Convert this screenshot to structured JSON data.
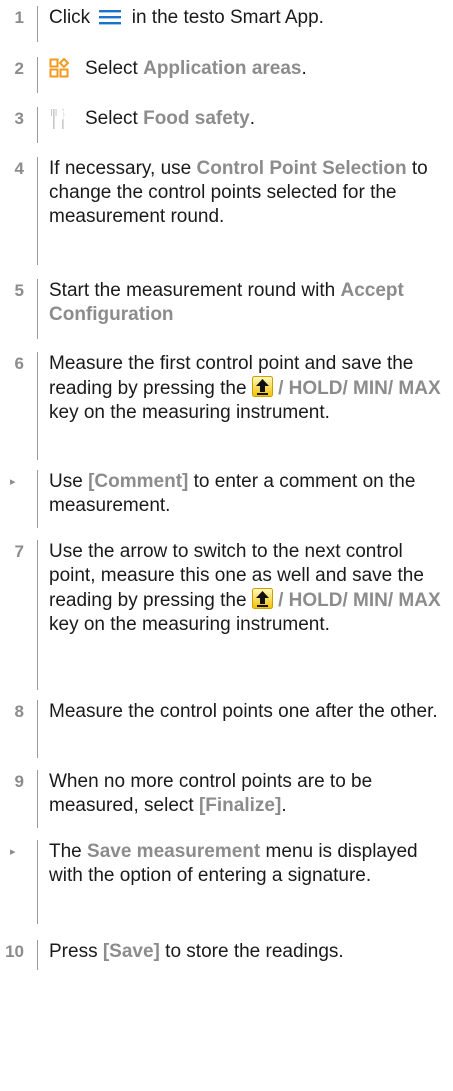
{
  "steps": [
    {
      "marker": "1",
      "parts": [
        {
          "t": "text",
          "v": "Click "
        },
        {
          "t": "icon",
          "name": "menu-icon"
        },
        {
          "t": "text",
          "v": " in the testo Smart App."
        }
      ]
    },
    {
      "marker": "2",
      "lead_icon": "grid-icon",
      "parts": [
        {
          "t": "text",
          "v": "Select "
        },
        {
          "t": "kw",
          "v": "Application areas"
        },
        {
          "t": "text",
          "v": "."
        }
      ]
    },
    {
      "marker": "3",
      "lead_icon": "fork-knife-icon",
      "parts": [
        {
          "t": "text",
          "v": "Select "
        },
        {
          "t": "kw",
          "v": "Food safety"
        },
        {
          "t": "text",
          "v": "."
        }
      ]
    },
    {
      "marker": "4",
      "parts": [
        {
          "t": "text",
          "v": "If necessary, use "
        },
        {
          "t": "kw",
          "v": "Control Point Selection"
        },
        {
          "t": "text",
          "v": " to change the control points selected for the measurement round."
        }
      ]
    },
    {
      "marker": "5",
      "parts": [
        {
          "t": "text",
          "v": "Start the measurement round with "
        },
        {
          "t": "kw",
          "v": "Accept Configuration"
        }
      ]
    },
    {
      "marker": "6",
      "parts": [
        {
          "t": "text",
          "v": "Measure the first control point and save the reading by pressing the "
        },
        {
          "t": "icon",
          "name": "upload-arrow-icon"
        },
        {
          "t": "kw",
          "v": " / HOLD/ MIN/ MAX"
        },
        {
          "t": "text",
          "v": " key on the measuring instrument."
        }
      ]
    },
    {
      "marker": "▸",
      "parts": [
        {
          "t": "text",
          "v": "Use "
        },
        {
          "t": "kw",
          "v": "[Comment]"
        },
        {
          "t": "text",
          "v": " to enter a comment on the measurement."
        }
      ]
    },
    {
      "marker": "7",
      "parts": [
        {
          "t": "text",
          "v": "Use the arrow to switch to the next control point, measure this one as well and save the reading by pressing the "
        },
        {
          "t": "icon",
          "name": "upload-arrow-icon"
        },
        {
          "t": "kw",
          "v": " / HOLD/ MIN/ MAX"
        },
        {
          "t": "text",
          "v": " key on the measuring instrument."
        }
      ]
    },
    {
      "marker": "8",
      "parts": [
        {
          "t": "text",
          "v": "Measure the control points one after the other."
        }
      ]
    },
    {
      "marker": "9",
      "parts": [
        {
          "t": "text",
          "v": "When no more control points are to be measured, select "
        },
        {
          "t": "kw",
          "v": "[Finalize]"
        },
        {
          "t": "text",
          "v": "."
        }
      ]
    },
    {
      "marker": "▸",
      "parts": [
        {
          "t": "text",
          "v": "The "
        },
        {
          "t": "kw",
          "v": "Save measurement"
        },
        {
          "t": "text",
          "v": " menu is displayed with the option of entering a signature."
        }
      ]
    },
    {
      "marker": "10",
      "parts": [
        {
          "t": "text",
          "v": "Press "
        },
        {
          "t": "kw",
          "v": "[Save]"
        },
        {
          "t": "text",
          "v": " to store the readings."
        }
      ]
    }
  ]
}
